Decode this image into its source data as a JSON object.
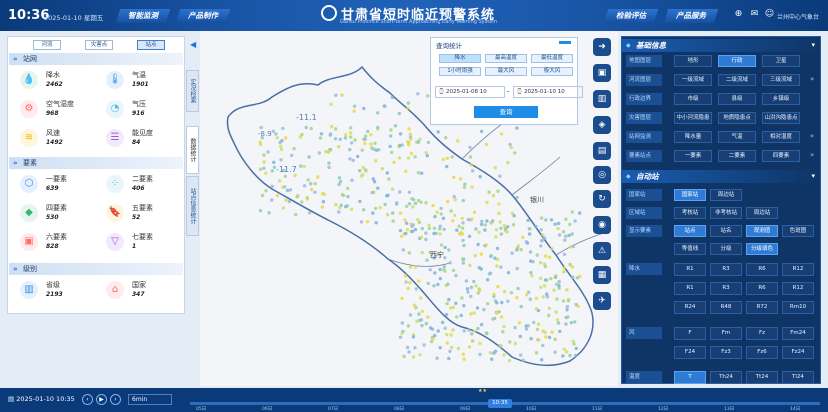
{
  "header": {
    "time": "10:36",
    "date": "2025-01-10 星期五",
    "nav_left": [
      "智能监测",
      "产品制作"
    ],
    "title": "甘肃省短时临近预警系统",
    "subtitle": "Gansu Province Short-term Approaching Early Warning System",
    "nav_right": [
      "检验评估",
      "产品服务"
    ],
    "user": "兰州中心气象台"
  },
  "left_panel": {
    "tabs": [
      "河流",
      "灾害点",
      "站点"
    ],
    "sections": [
      {
        "title": "站网",
        "items": [
          {
            "name": "降水",
            "value": "2462",
            "icon": "water-drops-icon",
            "color": "#3cb371"
          },
          {
            "name": "气温",
            "value": "1901",
            "icon": "thermometer-icon",
            "color": "#3a8ee6"
          },
          {
            "name": "空气湿度",
            "value": "968",
            "icon": "humidity-icon",
            "color": "#ff6b6b"
          },
          {
            "name": "气压",
            "value": "916",
            "icon": "gauge-icon",
            "color": "#4fb8e8"
          },
          {
            "name": "风速",
            "value": "1492",
            "icon": "wind-icon",
            "color": "#f4b400"
          },
          {
            "name": "能见度",
            "value": "84",
            "icon": "visibility-icon",
            "color": "#9b59d6"
          }
        ]
      },
      {
        "title": "要素",
        "items": [
          {
            "name": "一要素",
            "value": "639",
            "icon": "hexagon-icon",
            "color": "#3a8ee6"
          },
          {
            "name": "二要素",
            "value": "406",
            "icon": "circles-icon",
            "color": "#4fb8e8"
          },
          {
            "name": "四要素",
            "value": "530",
            "icon": "diamond-icon",
            "color": "#3cb371"
          },
          {
            "name": "五要素",
            "value": "52",
            "icon": "bookmark-icon",
            "color": "#f4b400"
          },
          {
            "name": "六要素",
            "value": "828",
            "icon": "cube-icon",
            "color": "#ff6b6b"
          },
          {
            "name": "七要素",
            "value": "1",
            "icon": "triangle-icon",
            "color": "#9b59d6"
          }
        ]
      },
      {
        "title": "级别",
        "items": [
          {
            "name": "省级",
            "value": "2193",
            "icon": "province-icon",
            "color": "#3a8ee6"
          },
          {
            "name": "国家",
            "value": "347",
            "icon": "national-icon",
            "color": "#ff6b6b"
          }
        ]
      }
    ]
  },
  "vertical_tabs": [
    "实况检索",
    "数据统计",
    "站点信息统计"
  ],
  "query": {
    "title": "查询统计",
    "buttons": [
      "降水",
      "最高温度",
      "最低温度",
      "1小时雨强",
      "最大风",
      "极大风"
    ],
    "start": "2025-01-08 10",
    "end": "2025-01-10 10",
    "submit": "查询"
  },
  "map_labels": {
    "cities": [
      "银川",
      "西宁"
    ],
    "temps": [
      "-8.9",
      "-11.1",
      "-11.7"
    ]
  },
  "right_panel": {
    "base_title": "基础信息",
    "base_rows": [
      {
        "label": "地图图层",
        "opts": [
          "地形",
          "行政",
          "卫星"
        ]
      },
      {
        "label": "河流图层",
        "opts": [
          "一级流域",
          "二级流域",
          "三级流域"
        ]
      },
      {
        "label": "行政边界",
        "opts": [
          "市级",
          "县级",
          "乡镇级"
        ]
      },
      {
        "label": "灾害图层",
        "opts": [
          "中小河流隐患",
          "地质隐患点",
          "山洪沟隐患点"
        ]
      },
      {
        "label": "站网监测",
        "opts": [
          "降水量",
          "气温",
          "相对湿度"
        ]
      },
      {
        "label": "要素站点",
        "opts": [
          "一要素",
          "二要素",
          "四要素"
        ]
      }
    ],
    "auto_title": "自动站",
    "auto_rows": [
      {
        "label": "国家站",
        "opts": [
          "国家站",
          "周边站"
        ]
      },
      {
        "label": "区域站",
        "opts": [
          "考核站",
          "非考核站",
          "周边站"
        ]
      },
      {
        "label": "显示要素",
        "opts": [
          "站点",
          "站名",
          "观测值",
          "色斑图"
        ]
      },
      {
        "label": "",
        "opts": [
          "等值线",
          "分级",
          "分级填色"
        ]
      }
    ],
    "rain_label": "降水",
    "rain": [
      "R1",
      "R3",
      "R6",
      "R12",
      "R1",
      "R3",
      "R6",
      "R12",
      "R24",
      "R48",
      "R72",
      "Rm10"
    ],
    "wind_label": "风",
    "wind": [
      "F",
      "Fm",
      "Fz",
      "Fm24",
      "F24",
      "Fz3",
      "Fz6",
      "Fz24"
    ],
    "temp_label": "温度",
    "temp": [
      "T",
      "Th24",
      "Tt24",
      "Tl24"
    ]
  },
  "timeline": {
    "current": "2025-01-10 10:35",
    "interval": "6min",
    "now": "10:35",
    "ticks": [
      "05日",
      "06日",
      "07日",
      "08日",
      "09日",
      "10日",
      "11日",
      "12日",
      "13日",
      "14日"
    ]
  }
}
